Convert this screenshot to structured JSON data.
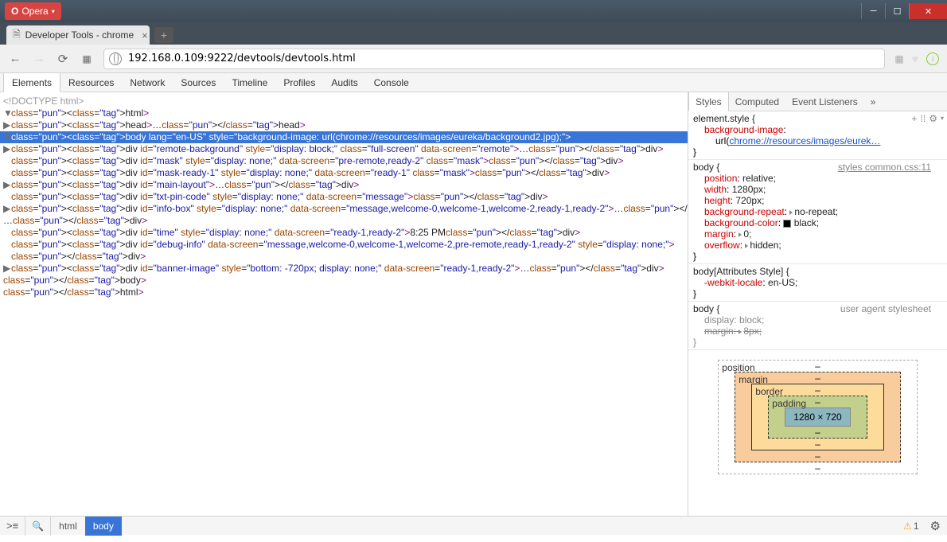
{
  "app": {
    "name": "Opera"
  },
  "tab": {
    "title": "Developer Tools - chrome"
  },
  "url": "192.168.0.109:9222/devtools/devtools.html",
  "devtools_tabs": [
    "Elements",
    "Resources",
    "Network",
    "Sources",
    "Timeline",
    "Profiles",
    "Audits",
    "Console"
  ],
  "devtools_active_tab": "Elements",
  "dom": {
    "doctype": "<!DOCTYPE html>",
    "html_open": "<html>",
    "head": "<head>…</head>",
    "body_open": "<body lang=\"en-US\" style=\"background-image: url(chrome://resources/images/eureka/background2.jpg);\">",
    "lines": [
      "<div id=\"remote-background\" style=\"display: block;\" class=\"full-screen\" data-screen=\"remote\">…</div>",
      "<div id=\"mask\" style=\"display: none;\" data-screen=\"pre-remote,ready-2\" class=\"mask\"></div>",
      "<div id=\"mask-ready-1\" style=\"display: none;\" data-screen=\"ready-1\" class=\"mask\"></div>",
      "<div id=\"main-layout\">…</div>",
      "<div id=\"txt-pin-code\" style=\"display: none;\" data-screen=\"message\"></div>",
      "<div id=\"info-box\" style=\"display: none;\" data-screen=\"message,welcome-0,welcome-1,welcome-2,ready-1,ready-2\">…</div>",
      "<div id=\"time\" style=\"display: none;\" data-screen=\"ready-1,ready-2\">8:25 PM</div>",
      "<div id=\"debug-info\" data-screen=\"message,welcome-0,welcome-1,welcome-2,pre-remote,ready-1,ready-2\" style=\"display: none;\">",
      "</div>",
      "<div id=\"banner-image\" style=\"bottom: -720px; display: none;\" data-screen=\"ready-1,ready-2\">…</div>"
    ],
    "body_close": "</body>",
    "html_close": "</html>"
  },
  "side_tabs": [
    "Styles",
    "Computed",
    "Event Listeners"
  ],
  "styles": {
    "elem": {
      "selector": "element.style {",
      "bgimg_prop": "background-image",
      "bgimg_val_prefix": "url(",
      "bgimg_link": "chrome://resources/images/eurek…"
    },
    "body_rule": {
      "selector": "body {",
      "source": "styles common.css:11",
      "position": "relative;",
      "width": "1280px;",
      "height": "720px;",
      "bgrepeat": "no-repeat;",
      "bgcolor": "black;",
      "margin": "0;",
      "overflow": "hidden;"
    },
    "attr_rule": {
      "selector": "body[Attributes Style] {",
      "locale": "en-US;"
    },
    "ua_rule": {
      "selector": "body {",
      "source": "user agent stylesheet",
      "display": "block;",
      "margin": "8px;"
    }
  },
  "boxmodel": {
    "pos": "position",
    "mar": "margin",
    "bor": "border",
    "pad": "padding",
    "dim": "1280 × 720"
  },
  "crumbs": [
    "html",
    "body"
  ],
  "warnings": "1"
}
